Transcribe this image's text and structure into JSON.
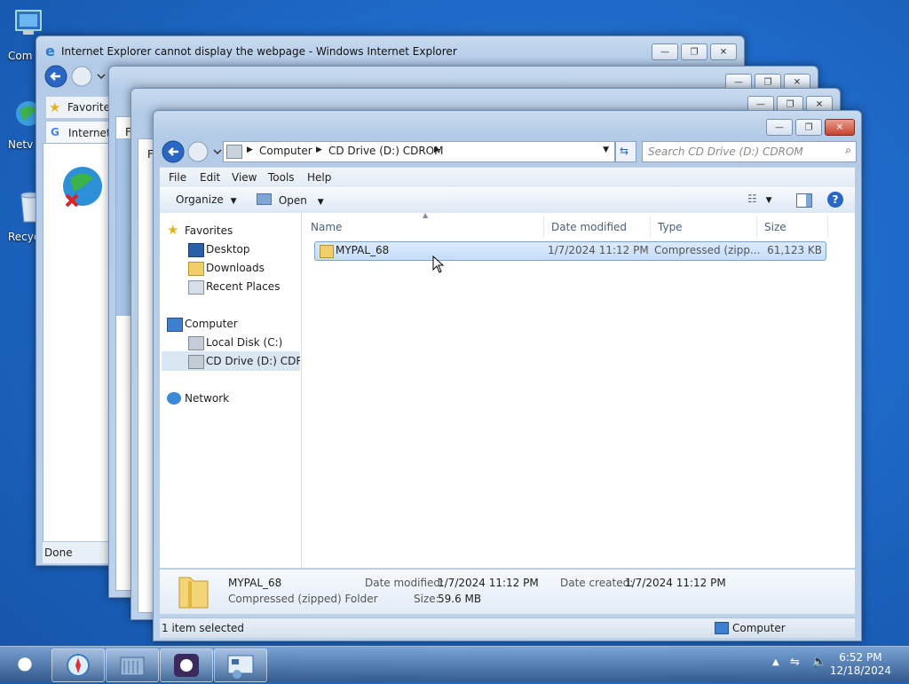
{
  "desktop": {
    "icons": [
      {
        "label": "Com",
        "icon": "computer-icon"
      },
      {
        "label": "Netv",
        "icon": "network-icon"
      },
      {
        "label": "Recyc",
        "icon": "recycle-bin-icon"
      }
    ]
  },
  "ie": {
    "title": "Internet Explorer cannot display the webpage - Windows Internet Explorer",
    "favorites_label": "Favorites",
    "tab_label": "Internet",
    "status": "Done"
  },
  "bg_windows": {
    "letter": "F"
  },
  "explorer": {
    "breadcrumb": [
      "Computer",
      "CD Drive (D:) CDROM"
    ],
    "search_placeholder": "Search CD Drive (D:) CDROM",
    "menu": [
      "File",
      "Edit",
      "View",
      "Tools",
      "Help"
    ],
    "toolbar": {
      "organize": "Organize",
      "open": "Open"
    },
    "nav": {
      "favorites": "Favorites",
      "desktop": "Desktop",
      "downloads": "Downloads",
      "recent": "Recent Places",
      "computer": "Computer",
      "local_disk": "Local Disk (C:)",
      "cd_drive": "CD Drive (D:) CDROM",
      "network": "Network"
    },
    "columns": [
      "Name",
      "Date modified",
      "Type",
      "Size"
    ],
    "files": [
      {
        "name": "MYPAL_68",
        "date": "1/7/2024 11:12 PM",
        "type": "Compressed (zipp...",
        "size": "61,123 KB"
      }
    ],
    "details": {
      "name": "MYPAL_68",
      "type": "Compressed (zipped) Folder",
      "date_modified_label": "Date modified:",
      "date_modified": "1/7/2024 11:12 PM",
      "size_label": "Size:",
      "size": "59.6 MB",
      "date_created_label": "Date created:",
      "date_created": "1/7/2024 11:12 PM"
    },
    "status": {
      "left": "1 item selected",
      "right": "Computer"
    }
  },
  "taskbar": {
    "time": "6:52 PM",
    "date": "12/18/2024"
  },
  "colors": {
    "accent": "#1f6ac9",
    "selection": "#c4ddf9",
    "close_red": "#c8432f"
  }
}
